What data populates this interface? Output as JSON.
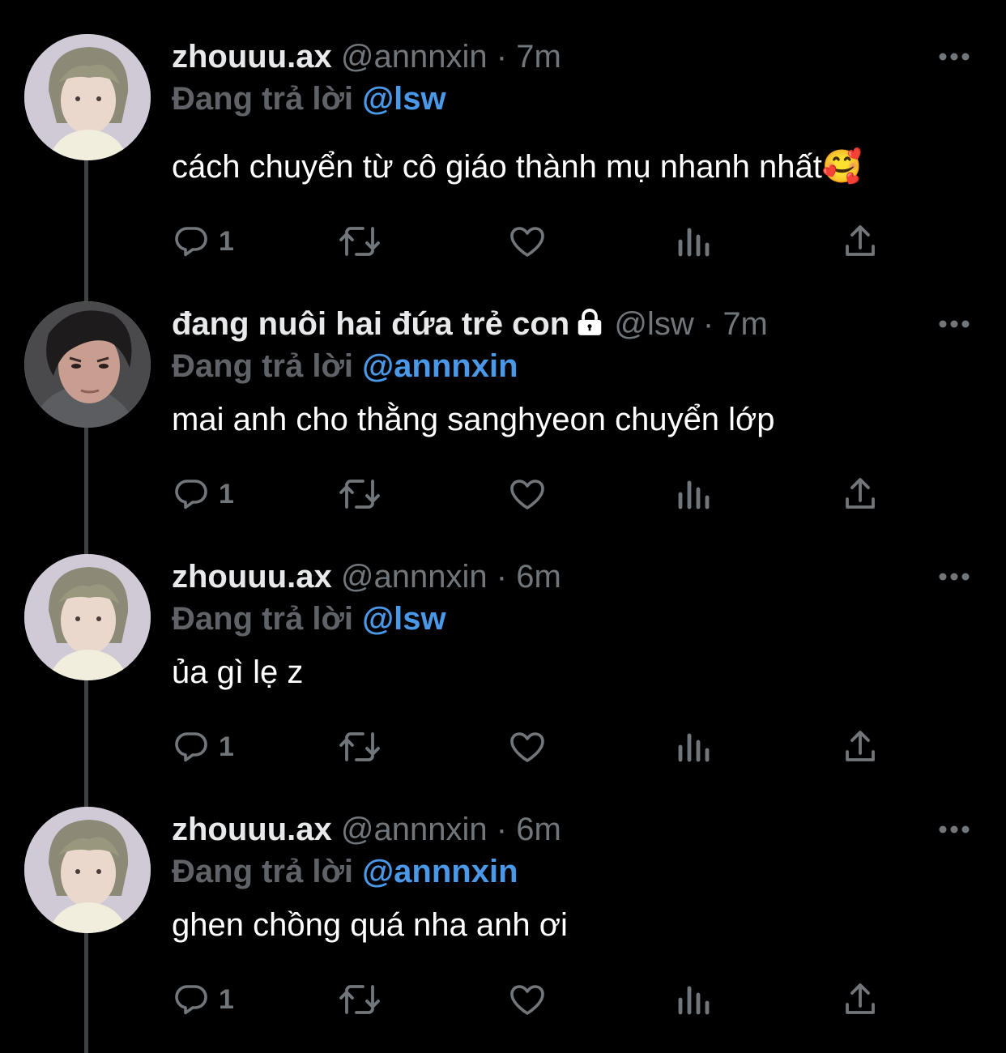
{
  "tweets": [
    {
      "display_name": "zhouuu.ax",
      "handle": "@annnxin",
      "separator": "·",
      "time": "7m",
      "locked": false,
      "replying_label": "Đang trả lời",
      "replying_to": "@lsw",
      "text": "cách chuyển từ cô giáo thành mụ nhanh nhất🥰",
      "reply_count": "1",
      "avatar": "avatar-light-haired-boy"
    },
    {
      "display_name": "đang nuôi hai đứa trẻ con",
      "handle": "@lsw",
      "separator": "·",
      "time": "7m",
      "locked": true,
      "replying_label": "Đang trả lời",
      "replying_to": "@annnxin",
      "text": "mai anh cho thằng sanghyeon chuyển lớp",
      "reply_count": "1",
      "avatar": "avatar-dark-haired-boy"
    },
    {
      "display_name": "zhouuu.ax",
      "handle": "@annnxin",
      "separator": "·",
      "time": "6m",
      "locked": false,
      "replying_label": "Đang trả lời",
      "replying_to": "@lsw",
      "text": "ủa gì lẹ z",
      "reply_count": "1",
      "avatar": "avatar-light-haired-boy"
    },
    {
      "display_name": "zhouuu.ax",
      "handle": "@annnxin",
      "separator": "·",
      "time": "6m",
      "locked": false,
      "replying_label": "Đang trả lời",
      "replying_to": "@annnxin",
      "text": "ghen chồng quá nha anh ơi",
      "reply_count": "1",
      "avatar": "avatar-light-haired-boy"
    }
  ],
  "icons": {
    "reply": "reply-icon",
    "retweet": "retweet-icon",
    "like": "heart-icon",
    "views": "analytics-icon",
    "share": "share-icon",
    "more": "more-icon",
    "lock": "lock-icon"
  },
  "colors": {
    "background": "#000000",
    "text": "#e7e9ea",
    "muted": "#71767b",
    "mention": "#4a99e9",
    "thread_line": "#3e4144"
  }
}
